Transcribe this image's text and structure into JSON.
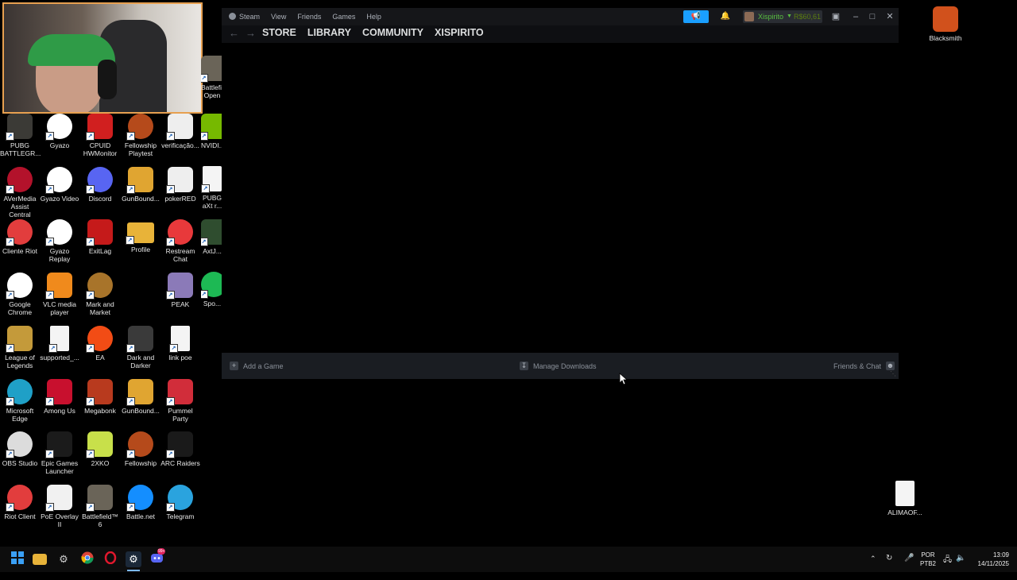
{
  "desktop": {
    "col1": [
      {
        "label": "PUBG BATTLEGR...",
        "icon": "pubg-icon",
        "color": "#3b3a36"
      },
      {
        "label": "AVerMedia Assist Central",
        "icon": "avermedia-icon",
        "color": "#b3122b"
      },
      {
        "label": "Cliente Riot",
        "icon": "riot-icon",
        "color": "#e23d3d"
      },
      {
        "label": "Google Chrome",
        "icon": "chrome-icon",
        "color": "#ffffff"
      },
      {
        "label": "League of Legends",
        "icon": "lol-icon",
        "color": "#c49a3a"
      },
      {
        "label": "Microsoft Edge",
        "icon": "edge-icon",
        "color": "#1fa0c7"
      },
      {
        "label": "OBS Studio",
        "icon": "obs-icon",
        "color": "#dcdcdc"
      },
      {
        "label": "Riot Client",
        "icon": "riot-client-icon",
        "color": "#e23d3d"
      }
    ],
    "col2": [
      {
        "label": "Gyazo",
        "icon": "gyazo-icon",
        "color": "#ffffff"
      },
      {
        "label": "Gyazo Video",
        "icon": "gyazo-video-icon",
        "color": "#ffffff"
      },
      {
        "label": "Gyazo Replay",
        "icon": "gyazo-replay-icon",
        "color": "#ffffff"
      },
      {
        "label": "VLC media player",
        "icon": "vlc-icon",
        "color": "#f08a1c"
      },
      {
        "label": "supported_...",
        "icon": "document-icon",
        "color": "#f4f4f4"
      },
      {
        "label": "Among Us",
        "icon": "among-us-icon",
        "color": "#c8102e"
      },
      {
        "label": "Epic Games Launcher",
        "icon": "epic-games-icon",
        "color": "#1b1b1b"
      },
      {
        "label": "PoE Overlay II",
        "icon": "poe-overlay-icon",
        "color": "#f1f1f1"
      }
    ],
    "col3": [
      {
        "label": "CPUID HWMonitor",
        "icon": "cpuid-icon",
        "color": "#d11f1f"
      },
      {
        "label": "Discord",
        "icon": "discord-icon",
        "color": "#5865f2"
      },
      {
        "label": "ExitLag",
        "icon": "exitlag-icon",
        "color": "#c51a1a"
      },
      {
        "label": "Mark and Market",
        "icon": "mark-market-icon",
        "color": "#a8742a"
      },
      {
        "label": "EA",
        "icon": "ea-icon",
        "color": "#f24c15"
      },
      {
        "label": "Megabonk",
        "icon": "megabonk-icon",
        "color": "#b83a1e"
      },
      {
        "label": "2XKO",
        "icon": "2xko-icon",
        "color": "#c8e04a"
      },
      {
        "label": "Battlefield™ 6",
        "icon": "battlefield-icon",
        "color": "#6a6458"
      }
    ],
    "col4": [
      {
        "label": "Fellowship Playtest",
        "icon": "fellowship-playtest-icon",
        "color": "#b54a1b"
      },
      {
        "label": "GunBound...",
        "icon": "gunbound-icon",
        "color": "#e0a531"
      },
      {
        "label": "Profile",
        "icon": "folder-icon",
        "color": "#e8b339"
      },
      {
        "label": "Dark and Darker",
        "icon": "dark-darker-icon",
        "color": "#3a3a3a"
      },
      {
        "label": "GunBound...",
        "icon": "gunbound-2-icon",
        "color": "#e0a531"
      },
      {
        "label": "Fellowship",
        "icon": "fellowship-icon",
        "color": "#b54a1b"
      },
      {
        "label": "Battle.net",
        "icon": "battlenet-icon",
        "color": "#148eff"
      }
    ],
    "col5": [
      {
        "label": "verificação...",
        "icon": "verification-icon",
        "color": "#eeeeee"
      },
      {
        "label": "pokerRED",
        "icon": "qr-icon",
        "color": "#eeeeee"
      },
      {
        "label": "Restream Chat",
        "icon": "restream-icon",
        "color": "#e8393b"
      },
      {
        "label": "PEAK",
        "icon": "peak-icon",
        "color": "#8b7ab8"
      },
      {
        "label": "link poe",
        "icon": "text-file-icon",
        "color": "#f4f4f4"
      },
      {
        "label": "Pummel Party",
        "icon": "pummel-party-icon",
        "color": "#d12d3a"
      },
      {
        "label": "ARC Raiders",
        "icon": "arc-raiders-icon",
        "color": "#1a1a1a"
      },
      {
        "label": "Telegram",
        "icon": "telegram-icon",
        "color": "#2aa3de"
      }
    ],
    "col6": [
      {
        "label": "Battlefi... Open",
        "icon": "battlefield-open-icon",
        "color": "#6a6458"
      },
      {
        "label": "NVIDI...",
        "icon": "nvidia-icon",
        "color": "#76b900"
      },
      {
        "label": "PUBG aXt r...",
        "icon": "pubg-text-icon",
        "color": "#f4f4f4"
      },
      {
        "label": "AxtJ...",
        "icon": "axt-icon",
        "color": "#2f4d2f"
      },
      {
        "label": "Spo...",
        "icon": "spotify-icon",
        "color": "#1db954"
      }
    ],
    "right": [
      {
        "label": "Blacksmith",
        "icon": "blacksmith-icon",
        "color": "#d1511c"
      },
      {
        "label": "ALIMAOF...",
        "icon": "alimaof-file-icon",
        "color": "#f4f4f4"
      }
    ]
  },
  "steam": {
    "menu": [
      "Steam",
      "View",
      "Friends",
      "Games",
      "Help"
    ],
    "user": {
      "name": "Xispirito",
      "wallet": "R$60,61"
    },
    "tabs": [
      "STORE",
      "LIBRARY",
      "COMMUNITY",
      "XISPIRITO"
    ],
    "bottom": {
      "add_game": "Add a Game",
      "manage_downloads": "Manage Downloads",
      "friends_chat": "Friends & Chat"
    },
    "colors": {
      "accent": "#1a9fff",
      "username": "#59bf40",
      "wallet": "#5c7e10"
    }
  },
  "taskbar": {
    "lang1": "POR",
    "lang2": "PTB2",
    "time": "13:09",
    "date": "14/11/2025",
    "badge": "99+"
  }
}
